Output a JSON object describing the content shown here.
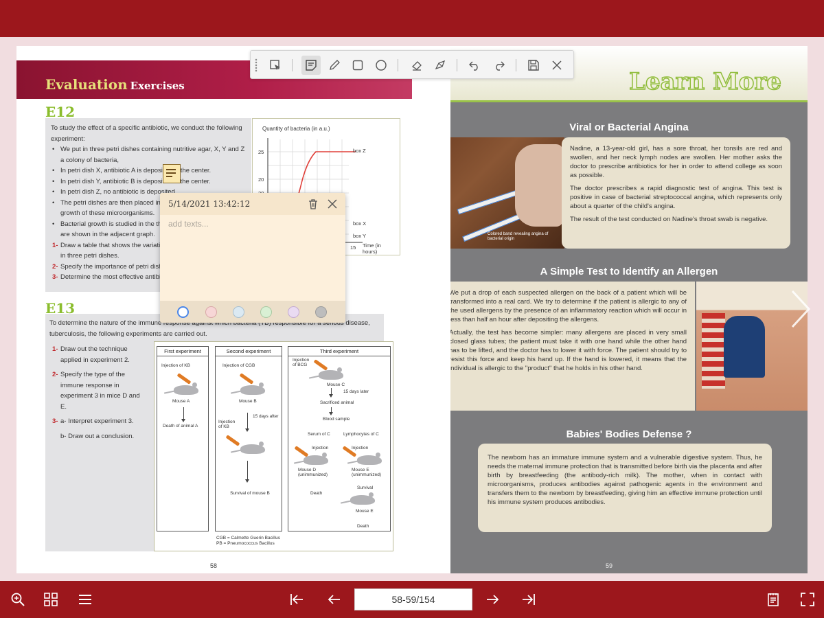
{
  "toolbar": {
    "tools": [
      "select-tool-icon",
      "note-tool-icon",
      "pencil-icon",
      "rectangle-icon",
      "ellipse-icon",
      "eraser-icon",
      "highlighter-icon",
      "undo-icon",
      "redo-icon",
      "save-icon",
      "close-icon"
    ]
  },
  "left_page": {
    "section_title": "Evaluation",
    "section_subtitle": "Exercises",
    "e12": {
      "label": "E12",
      "intro": "To study the effect of a specific antibiotic, we conduct the following experiment:",
      "bullets": [
        "We put in three petri dishes containing nutritive agar, X, Y and Z a colony of bacteria,",
        "In petri dish X, antibiotic A is deposited in the center.",
        "In petri dish Y, antibiotic B is deposited in the center.",
        "In petri dish Z, no antibiotic is deposited.",
        "The petri dishes are then placed in conditions favorable for the growth of these microorganisms.",
        "Bacterial growth is studied in the three dishes and the results are shown in the adjacent graph."
      ],
      "questions": [
        {
          "num": "1-",
          "text": "Draw a table that shows the variation of the quantity of bacteria in three petri dishes."
        },
        {
          "num": "2-",
          "text": "Specify the importance of petri dish Z."
        },
        {
          "num": "3-",
          "text": "Determine the most effective antibiotic."
        }
      ],
      "graph": {
        "ylabel": "Quantity of bacteria (in a.u.)",
        "yticks": [
          "25",
          "20",
          "20",
          "20"
        ],
        "curve_labels": [
          "box Z",
          "box X",
          "box Y"
        ],
        "xlabel": "Time (in hours)",
        "xtick": "15"
      }
    },
    "e13": {
      "label": "E13",
      "intro": "To determine the nature of the immune response against which bacteria (TB) responsible for a serious disease, tuberculosis, the following experiments are carried out.",
      "questions": [
        {
          "num": "1-",
          "text": "Draw out the technique applied in experiment 2."
        },
        {
          "num": "2-",
          "text": "Specify the type of the immune response in experiment 3 in mice D and E."
        },
        {
          "num": "3-",
          "text": "a- Interpret experiment 3."
        },
        {
          "num": "",
          "text": "b- Draw out a conclusion."
        }
      ],
      "experiments": {
        "first": "First experiment",
        "second": "Second experiment",
        "third": "Third experiment",
        "exp1_labels": [
          "Injection of KB",
          "Mouse A",
          "Death of animal A"
        ],
        "exp2_labels": [
          "Injection of CGB",
          "Mouse B",
          "Injection of KB",
          "15 days after",
          "Survival of mouse B"
        ],
        "exp3_labels": [
          "Injection of BCG",
          "Mouse C",
          "15 days later",
          "Sacrificed animal",
          "Blood sample",
          "Serum of C",
          "Lymphocytes of C",
          "Injection",
          "Injection",
          "Mouse D (unimmunized)",
          "Mouse E (unimmunized)",
          "Death",
          "Survival",
          "Mouse E",
          "Death"
        ],
        "footnote": "CGB = Calmette Guerin Bacillus\nPB = Pneumococcus Bacillus"
      }
    },
    "page_number": "58"
  },
  "right_page": {
    "banner": "Learn More",
    "section1": {
      "heading": "Viral or Bacterial Angina",
      "photo_caption": "Colored band revealing angina of bacterial origin",
      "paragraphs": [
        "Nadine, a 13-year-old girl, has a sore throat, her tonsils are red and swollen, and her neck lymph nodes are swollen. Her mother asks the doctor to prescribe antibiotics for her in order to attend college as soon as possible.",
        "The doctor prescribes a rapid diagnostic test of angina. This test is positive in case of bacterial streptococcal angina, which represents only about a quarter of the child's angina.",
        "The result of the test conducted on Nadine's throat swab is negative."
      ]
    },
    "section2": {
      "heading": "A Simple Test to Identify an Allergen",
      "paragraphs": [
        "We put a drop of each suspected allergen on the back of a patient which will be transformed into a real card. We try to determine if the patient is allergic to any of the used allergens by the presence of an inflammatory reaction which will occur in less than half an hour after depositing the allergens.",
        "Actually, the test has become simpler: many allergens are placed in very small closed glass tubes; the patient must take it with one hand while the other hand has to be lifted, and the doctor has to lower it with force. The patient should try to resist this force and keep his hand up. If the hand is lowered, it means that the individual is allergic to the \"product\" that he holds in his other hand."
      ]
    },
    "section3": {
      "heading": "Babies' Bodies Defense ?",
      "paragraphs": [
        "The newborn has an immature immune system and a vulnerable digestive system. Thus, he needs the maternal immune protection that is transmitted before birth via the placenta and after birth by breastfeeding (the antibody-rich milk). The mother, when in contact with microorganisms, produces antibodies against pathogenic agents in the environment and transfers them to the newborn by breastfeeding, giving him an effective immune protection until his immune system produces antibodies."
      ]
    },
    "page_number": "59"
  },
  "sticky_note": {
    "timestamp": "5/14/2021 13:42:12",
    "placeholder": "add texts...",
    "colors": [
      "#ffffff",
      "#f7d6d6",
      "#dbe9f2",
      "#d9f0d4",
      "#eadbf2",
      "#bdbdbd"
    ],
    "selected_color_border": "#4a86e8"
  },
  "bottom_bar": {
    "page_indicator": "58-59/154",
    "left_icons": [
      "zoom-icon",
      "thumbnails-icon",
      "menu-icon"
    ],
    "nav_icons": [
      "first-page-icon",
      "prev-page-icon",
      "next-page-icon",
      "last-page-icon"
    ],
    "right_icons": [
      "notes-icon",
      "fullscreen-icon"
    ]
  },
  "colors": {
    "brand": "#9c171c",
    "background": "#f1dde0",
    "accent_green": "#8bbd2d"
  }
}
